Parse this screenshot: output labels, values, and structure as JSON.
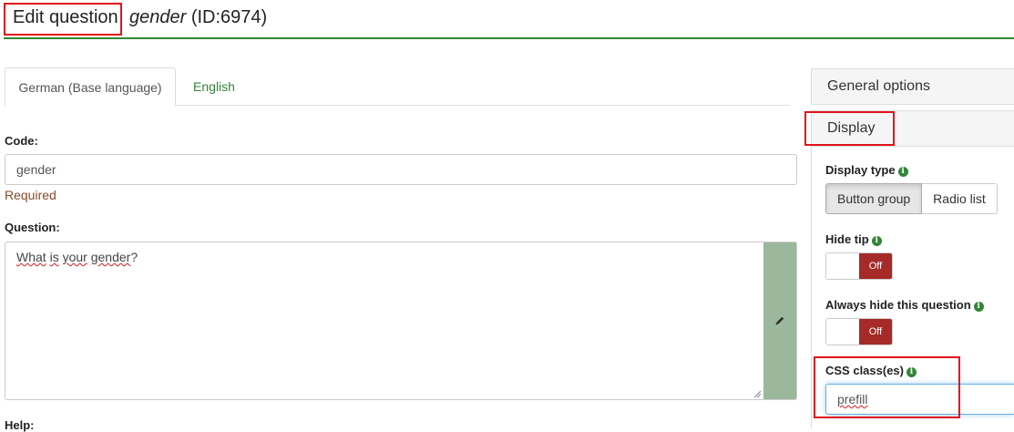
{
  "header": {
    "title": "Edit question",
    "question_code": "gender",
    "question_id": "(ID:6974)"
  },
  "tabs": [
    {
      "label": "German (Base language)",
      "active": true
    },
    {
      "label": "English",
      "active": false
    }
  ],
  "form": {
    "code_label": "Code:",
    "code_value": "gender",
    "code_required": "Required",
    "question_label": "Question:",
    "question_text_words": [
      "What",
      "is",
      "your",
      "gender"
    ],
    "question_text_end": "?",
    "help_label": "Help:"
  },
  "right_panel": {
    "general_options_label": "General options",
    "display_label": "Display",
    "display_type_label": "Display type",
    "display_type_options": [
      "Button group",
      "Radio list"
    ],
    "display_type_selected": "Button group",
    "hide_tip_label": "Hide tip",
    "hide_tip_value": "Off",
    "always_hide_label": "Always hide this question",
    "always_hide_value": "Off",
    "css_class_label": "CSS class(es)",
    "css_class_value": "prefill"
  },
  "colors": {
    "accent_green": "#328637",
    "highlight_red": "#e2141b",
    "toggle_off": "#a52a28",
    "edit_button": "#9bb89c"
  },
  "icons": [
    "info-icon",
    "pencil-icon",
    "resize-grip-icon"
  ]
}
